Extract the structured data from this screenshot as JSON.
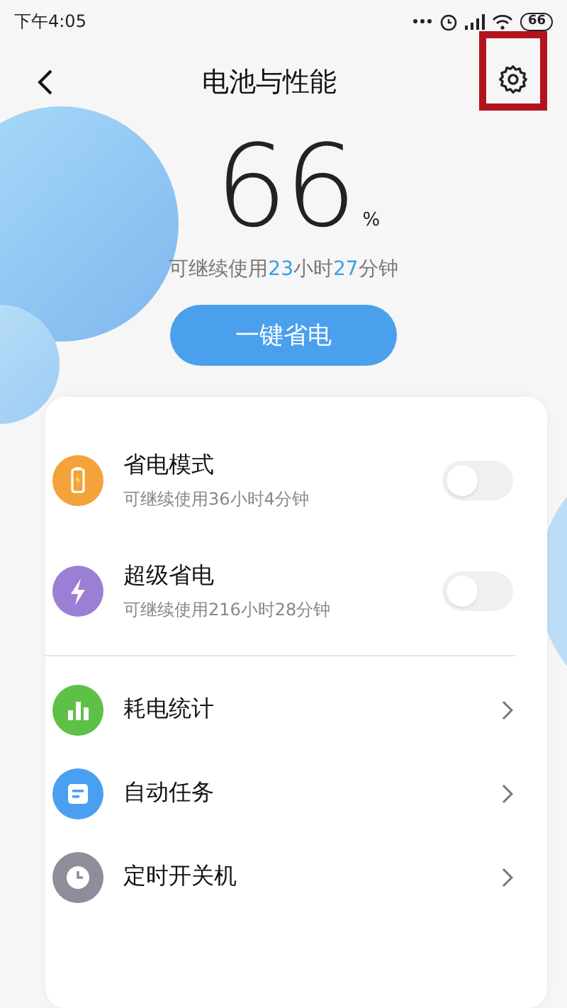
{
  "status_bar": {
    "time": "下午4:05",
    "battery": "66"
  },
  "header": {
    "title": "电池与性能",
    "settings_highlighted": true
  },
  "battery": {
    "percent": "66",
    "unit": "%",
    "remaining": [
      {
        "kind": "plain",
        "text": "可继续使用"
      },
      {
        "kind": "number",
        "text": "23"
      },
      {
        "kind": "plain",
        "text": "小时"
      },
      {
        "kind": "number",
        "text": "27"
      },
      {
        "kind": "plain",
        "text": "分钟"
      }
    ]
  },
  "save_button": {
    "label": "一键省电"
  },
  "modes": [
    {
      "kind": "battery",
      "title": "省电模式",
      "subtitle": "可继续使用36小时4分钟",
      "on": false,
      "color": "#f4a23a"
    },
    {
      "kind": "bolt",
      "title": "超级省电",
      "subtitle": "可继续使用216小时28分钟",
      "on": false,
      "color": "#9b7fd4"
    }
  ],
  "links": [
    {
      "kind": "chart",
      "title": "耗电统计",
      "color": "#5cc146"
    },
    {
      "kind": "task",
      "title": "自动任务",
      "color": "#4a9ff0"
    },
    {
      "kind": "clock",
      "title": "定时开关机",
      "color": "#8e8e9a"
    }
  ]
}
